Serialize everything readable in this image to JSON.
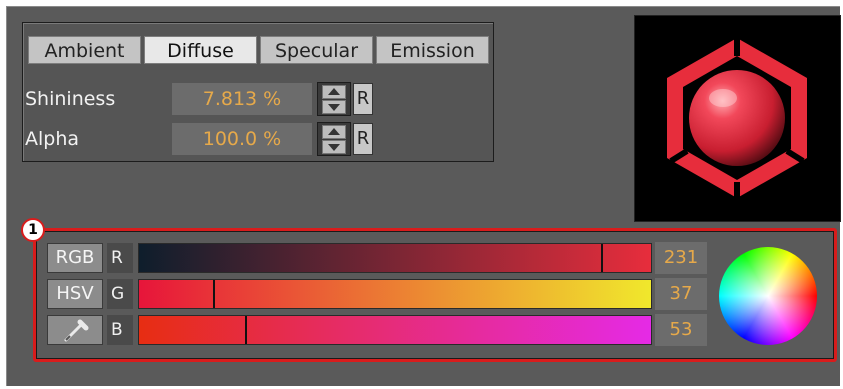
{
  "tabs": [
    {
      "label": "Ambient",
      "active": false
    },
    {
      "label": "Diffuse",
      "active": true
    },
    {
      "label": "Specular",
      "active": false
    },
    {
      "label": "Emission",
      "active": false
    }
  ],
  "params": [
    {
      "label": "Shininess",
      "value": "7.813 %",
      "reset": "R"
    },
    {
      "label": "Alpha",
      "value": "100.0 %",
      "reset": "R"
    }
  ],
  "color": {
    "callout": "1",
    "modes": {
      "rgb": "RGB",
      "hsv": "HSV"
    },
    "picker_icon": "eyedropper-icon",
    "channels": [
      {
        "label": "R",
        "value": "231",
        "level": 0.906
      },
      {
        "label": "G",
        "value": "37",
        "level": 0.145
      },
      {
        "label": "B",
        "value": "53",
        "level": 0.208
      }
    ]
  },
  "colors": {
    "accent": "#d81c1c",
    "value_text": "#e6a94a",
    "material": "#e72d3c"
  }
}
